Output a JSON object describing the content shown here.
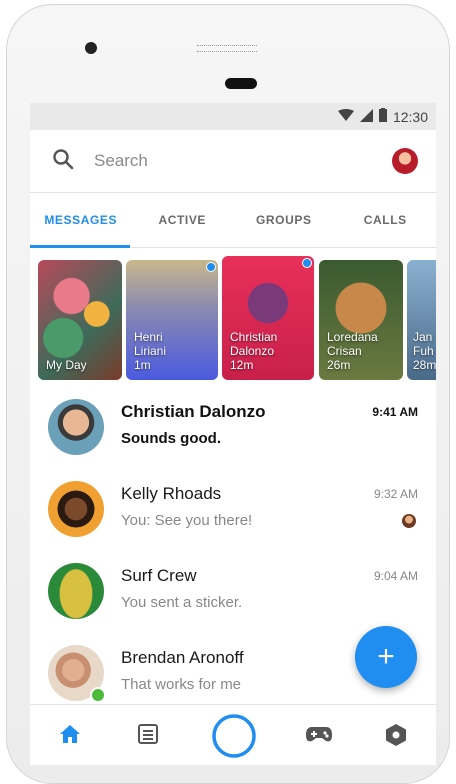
{
  "status_bar": {
    "time": "12:30",
    "icons": [
      "wifi-icon",
      "signal-icon",
      "battery-icon"
    ]
  },
  "search": {
    "placeholder": "Search",
    "icon": "search-icon"
  },
  "tabs": [
    {
      "label": "MESSAGES",
      "active": true
    },
    {
      "label": "ACTIVE",
      "active": false
    },
    {
      "label": "GROUPS",
      "active": false
    },
    {
      "label": "CALLS",
      "active": false
    }
  ],
  "stories": [
    {
      "line1": "My Day",
      "line2": "",
      "line3": ""
    },
    {
      "line1": "Henri",
      "line2": "Liriani",
      "line3": "1m"
    },
    {
      "line1": "Christian",
      "line2": "Dalonzo",
      "line3": "12m"
    },
    {
      "line1": "Loredana",
      "line2": "Crisan",
      "line3": "26m"
    },
    {
      "line1": "Jan",
      "line2": "Fuh",
      "line3": "28m"
    }
  ],
  "conversations": [
    {
      "name": "Christian Dalonzo",
      "preview": "Sounds good.",
      "time": "9:41 AM",
      "unread": true
    },
    {
      "name": "Kelly Rhoads",
      "preview": "You: See you there!",
      "time": "9:32 AM",
      "unread": false
    },
    {
      "name": "Surf Crew",
      "preview": "You sent a sticker.",
      "time": "9:04 AM",
      "unread": false
    },
    {
      "name": "Brendan Aronoff",
      "preview": "That works for me",
      "time": "",
      "unread": false
    }
  ],
  "fab": {
    "label": "+"
  },
  "bottom_nav": [
    "home-icon",
    "list-icon",
    "camera-icon",
    "games-icon",
    "discover-icon"
  ],
  "colors": {
    "accent": "#1f8ef0",
    "online": "#4cbb3a"
  }
}
